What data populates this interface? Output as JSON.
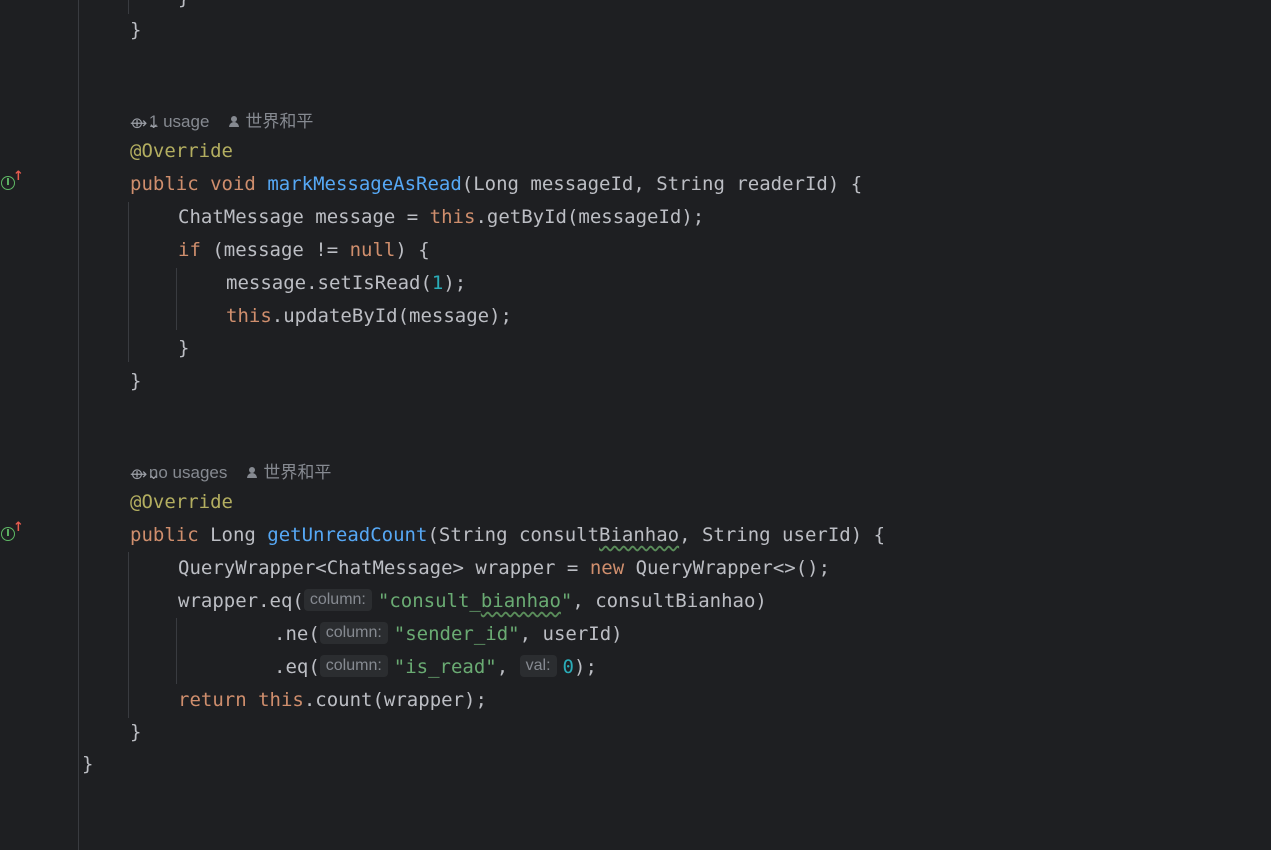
{
  "editor": {
    "colors": {
      "background": "#1e1f22",
      "keyword": "#cf8e6d",
      "annotation": "#b3ae60",
      "method": "#56a8f5",
      "number": "#2aacb8",
      "string": "#6aab73",
      "text": "#bcbec4"
    },
    "top_brace_partial": "}",
    "close_brace_1": "}",
    "method1": {
      "usages": "1 usage",
      "author": "世界和平",
      "ai_icon": "ai-assistant-icon",
      "annotation": "@Override",
      "kw_public": "public",
      "kw_void": "void",
      "name": "markMessageAsRead",
      "params": "(Long messageId, String readerId) {",
      "l1_type": "ChatMessage message = ",
      "l1_this": "this",
      "l1_rest": ".getById(messageId);",
      "l2_if": "if",
      "l2_mid": " (message != ",
      "l2_null": "null",
      "l2_end": ") {",
      "l3_a": "message.setIsRead(",
      "l3_num": "1",
      "l3_b": ");",
      "l4_this": "this",
      "l4_rest": ".updateById(message);",
      "l5": "}",
      "close": "}"
    },
    "method2": {
      "usages": "no usages",
      "author": "世界和平",
      "ai_icon": "ai-assistant-icon",
      "annotation": "@Override",
      "kw_public": "public",
      "type": " Long ",
      "name": "getUnreadCount",
      "params_a": "(String consult",
      "params_wavy": "Bianhao",
      "params_b": ", String userId) {",
      "l1_a": "QueryWrapper<ChatMessage> wrapper = ",
      "l1_new": "new",
      "l1_b": " QueryWrapper<>();",
      "l2_a": "wrapper.eq(",
      "hint_column": "column:",
      "l2_str_a": "\"consult_",
      "l2_str_wavy": "bianhao",
      "l2_str_b": "\"",
      "l2_b": ", consultBianhao)",
      "l3_a": ".ne(",
      "l3_str": "\"sender_id\"",
      "l3_b": ", userId)",
      "l4_a": ".eq(",
      "l4_str": "\"is_read\"",
      "l4_comma": ", ",
      "hint_val": "val:",
      "l4_num": "0",
      "l4_b": ");",
      "l5_return": "return",
      "l5_this": "this",
      "l5_rest": ".count(wrapper);",
      "close": "}"
    },
    "class_close": "}"
  }
}
